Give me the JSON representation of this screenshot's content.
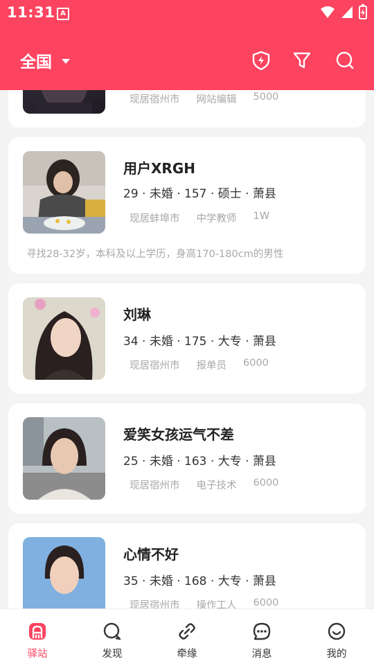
{
  "status": {
    "time": "11:31",
    "notif_letter": "A"
  },
  "topbar": {
    "location": "全国"
  },
  "partial_card": {
    "tags": [
      "现居宿州市",
      "网站编辑",
      "5000"
    ]
  },
  "profiles": [
    {
      "name": "用户XRGH",
      "details": "29 · 未婚 · 157 · 硕士 · 萧县",
      "tags": [
        "现居蚌埠市",
        "中学教师",
        "1W"
      ],
      "desc": "寻找28-32岁，本科及以上学历，身高170-180cm的男性"
    },
    {
      "name": "刘琳",
      "details": "34 · 未婚 · 175 · 大专 · 萧县",
      "tags": [
        "现居宿州市",
        "报单员",
        "6000"
      ]
    },
    {
      "name": "爱笑女孩运气不差",
      "details": "25 · 未婚 · 163 · 大专 · 萧县",
      "tags": [
        "现居宿州市",
        "电子技术",
        "6000"
      ]
    },
    {
      "name": "心情不好",
      "details": "35 · 未婚 · 168 · 大专 · 萧县",
      "tags": [
        "现居宿州市",
        "操作工人",
        "6000"
      ]
    }
  ],
  "tabs": [
    {
      "label": "驿站",
      "icon": "station-icon",
      "active": true
    },
    {
      "label": "发现",
      "icon": "discover-icon"
    },
    {
      "label": "牵缘",
      "icon": "link-icon"
    },
    {
      "label": "消息",
      "icon": "message-icon"
    },
    {
      "label": "我的",
      "icon": "profile-icon"
    }
  ],
  "colors": {
    "brand": "#fc4360",
    "background": "#f4f4f4",
    "tag_text": "#a8a8a8"
  }
}
